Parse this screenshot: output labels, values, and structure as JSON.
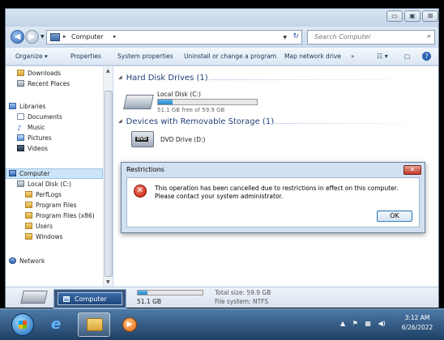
{
  "window": {
    "caption_buttons": {
      "minimize": "▭",
      "maximize": "▣",
      "close": "⊠"
    }
  },
  "address_bar": {
    "path": "Computer",
    "separator": "▸",
    "search_placeholder": "Search Computer"
  },
  "command_bar": {
    "organize": "Organize ▾",
    "properties": "Properties",
    "system_properties": "System properties",
    "uninstall": "Uninstall or change a program",
    "map_drive": "Map network drive",
    "more": "»"
  },
  "nav_pane": {
    "items": [
      {
        "label": "Downloads",
        "icon": "folder-icon"
      },
      {
        "label": "Recent Places",
        "icon": "recent-places-icon"
      },
      {
        "label": "Libraries",
        "icon": "libraries-icon"
      },
      {
        "label": "Documents",
        "icon": "documents-icon"
      },
      {
        "label": "Music",
        "icon": "music-icon"
      },
      {
        "label": "Pictures",
        "icon": "pictures-icon"
      },
      {
        "label": "Videos",
        "icon": "videos-icon"
      },
      {
        "label": "Computer",
        "icon": "computer-icon"
      },
      {
        "label": "Local Disk (C:)",
        "icon": "drive-icon"
      },
      {
        "label": "PerfLogs",
        "icon": "folder-icon"
      },
      {
        "label": "Program Files",
        "icon": "folder-icon"
      },
      {
        "label": "Program Files (x86)",
        "icon": "folder-icon"
      },
      {
        "label": "Users",
        "icon": "folder-icon"
      },
      {
        "label": "Windows",
        "icon": "folder-icon"
      },
      {
        "label": "Network",
        "icon": "network-icon"
      }
    ]
  },
  "content": {
    "hard_disk_group": "Hard Disk Drives (1)",
    "local_disk": {
      "name": "Local Disk (C:)",
      "free_text": "51.1 GB free of 59.9 GB",
      "used_fraction": 0.147
    },
    "removable_group": "Devices with Removable Storage (1)",
    "dvd": {
      "name": "DVD Drive (D:)",
      "badge": "DVD"
    }
  },
  "details": {
    "free": "51.1 GB",
    "total_size": "Total size: 59.9 GB",
    "file_system": "File system: NTFS",
    "used_fraction": 0.147
  },
  "thumbnail": {
    "label": "Computer"
  },
  "dialog": {
    "title": "Restrictions",
    "close": "✕",
    "message": "This operation has been cancelled due to restrictions in effect on this computer. Please contact your system administrator.",
    "ok": "OK",
    "error_glyph": "✕"
  },
  "taskbar": {
    "clock_time": "3:12 AM",
    "clock_date": "6/26/2022",
    "tray": [
      "▲",
      "⚑",
      "▦",
      "◀)"
    ]
  },
  "colors": {
    "accent": "#2a86c8",
    "error": "#c2190a",
    "taskbar": "#1f3f64"
  }
}
